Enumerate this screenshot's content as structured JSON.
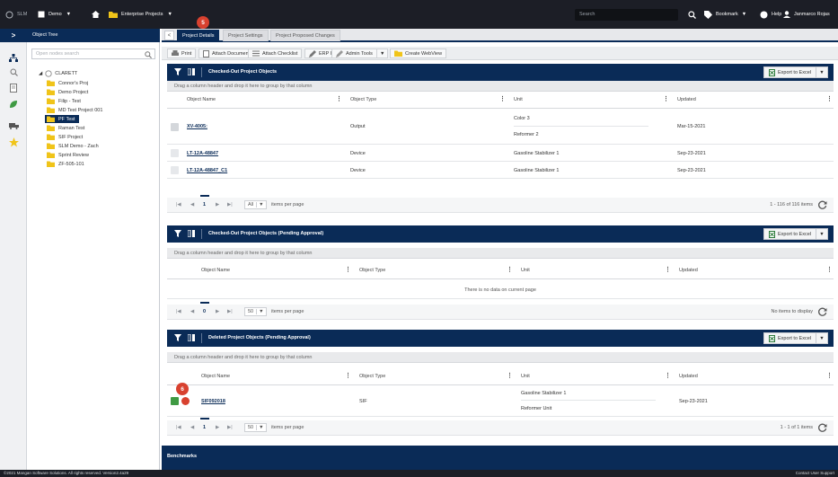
{
  "topbar": {
    "app": "SLM",
    "module": "Demo",
    "section": "Enterprise Projects",
    "search_placeholder": "Search",
    "bookmark": "Bookmark",
    "help": "Help",
    "user": "Janmarco Rojas"
  },
  "left_nav": {
    "collapse_glyph": ">"
  },
  "tree": {
    "title": "Object Tree",
    "search_placeholder": "Open nodes search",
    "root": "CLARETT",
    "items": [
      "Connor's Proj",
      "Demo Project",
      "Filip - Test",
      "MD Test Project 001",
      "PF Test",
      "Raman Test",
      "SIF Project",
      "SLM Demo - Zach",
      "Sprint Review",
      "ZF-505-101"
    ],
    "selected_index": 4
  },
  "callouts": {
    "tab_badge": "5",
    "row_badge": "6"
  },
  "tabs": {
    "back": "<",
    "items": [
      "Project Details",
      "Project Settings",
      "Project Proposed Changes"
    ],
    "active_index": 0
  },
  "toolbar": {
    "print": "Print",
    "attach_document": "Attach Document",
    "attach_checklist": "Attach Checklist",
    "erp_id": "ERP ID",
    "admin_tools": "Admin Tools",
    "create_webview": "Create WebView"
  },
  "panels": [
    {
      "title": "Checked-Out Project Objects",
      "export_label": "Export to Excel",
      "group_hint": "Drag a column header and drop it here to group by that column",
      "columns": [
        "Object Name",
        "Object Type",
        "Unit",
        "Updated"
      ],
      "rows": [
        {
          "name": "XV-4005:",
          "type": "Output",
          "units": [
            "Color 3",
            "Reformer 2"
          ],
          "updated": "Mar-15-2021"
        },
        {
          "name": "LT-12A-48847",
          "type": "Device",
          "units": [
            "Gasoline Stabilizer 1"
          ],
          "updated": "Sep-23-2021"
        },
        {
          "name": "LT-12A-48847_C1",
          "type": "Device",
          "units": [
            "Gasoline Stabilizer 1"
          ],
          "updated": "Sep-23-2021"
        }
      ],
      "pager": {
        "first": "|◀",
        "prev": "◀",
        "current": "1",
        "next": "▶",
        "last": "▶|",
        "per_page": "All",
        "per_page_label": "items per page",
        "info": "1 - 116 of 116 items"
      }
    },
    {
      "title": "Checked-Out Project Objects (Pending Approval)",
      "export_label": "Export to Excel",
      "group_hint": "Drag a column header and drop it here to group by that column",
      "columns": [
        "Object Name",
        "Object Type",
        "Unit",
        "Updated"
      ],
      "empty_text": "There is no data on current page",
      "pager": {
        "first": "|◀",
        "prev": "◀",
        "current": "0",
        "next": "▶",
        "last": "▶|",
        "per_page": "50",
        "per_page_label": "items per page",
        "info": "No items to display"
      }
    },
    {
      "title": "Deleted Project Objects (Pending Approval)",
      "export_label": "Export to Excel",
      "group_hint": "Drag a column header and drop it here to group by that column",
      "columns": [
        "Object Name",
        "Object Type",
        "Unit",
        "Updated"
      ],
      "rows": [
        {
          "name": "SIF092018",
          "type": "SIF",
          "units": [
            "Gasoline Stabilizer 1",
            "Reformer Unit"
          ],
          "updated": "Sep-23-2021"
        }
      ],
      "pager": {
        "first": "|◀",
        "prev": "◀",
        "current": "1",
        "next": "▶",
        "last": "▶|",
        "per_page": "50",
        "per_page_label": "items per page",
        "info": "1 - 1 of 1 items"
      }
    }
  ],
  "benchmarks": {
    "title": "Benchmarks"
  },
  "footer": {
    "left": "©2021 Mangan Software Solutions. All rights reserved. Version2.4a29",
    "right": "Contact User Support"
  },
  "colors": {
    "navy": "#0a2b57",
    "topbar": "#1c1e26",
    "callout": "#d8412f",
    "folder": "#f0c419"
  }
}
